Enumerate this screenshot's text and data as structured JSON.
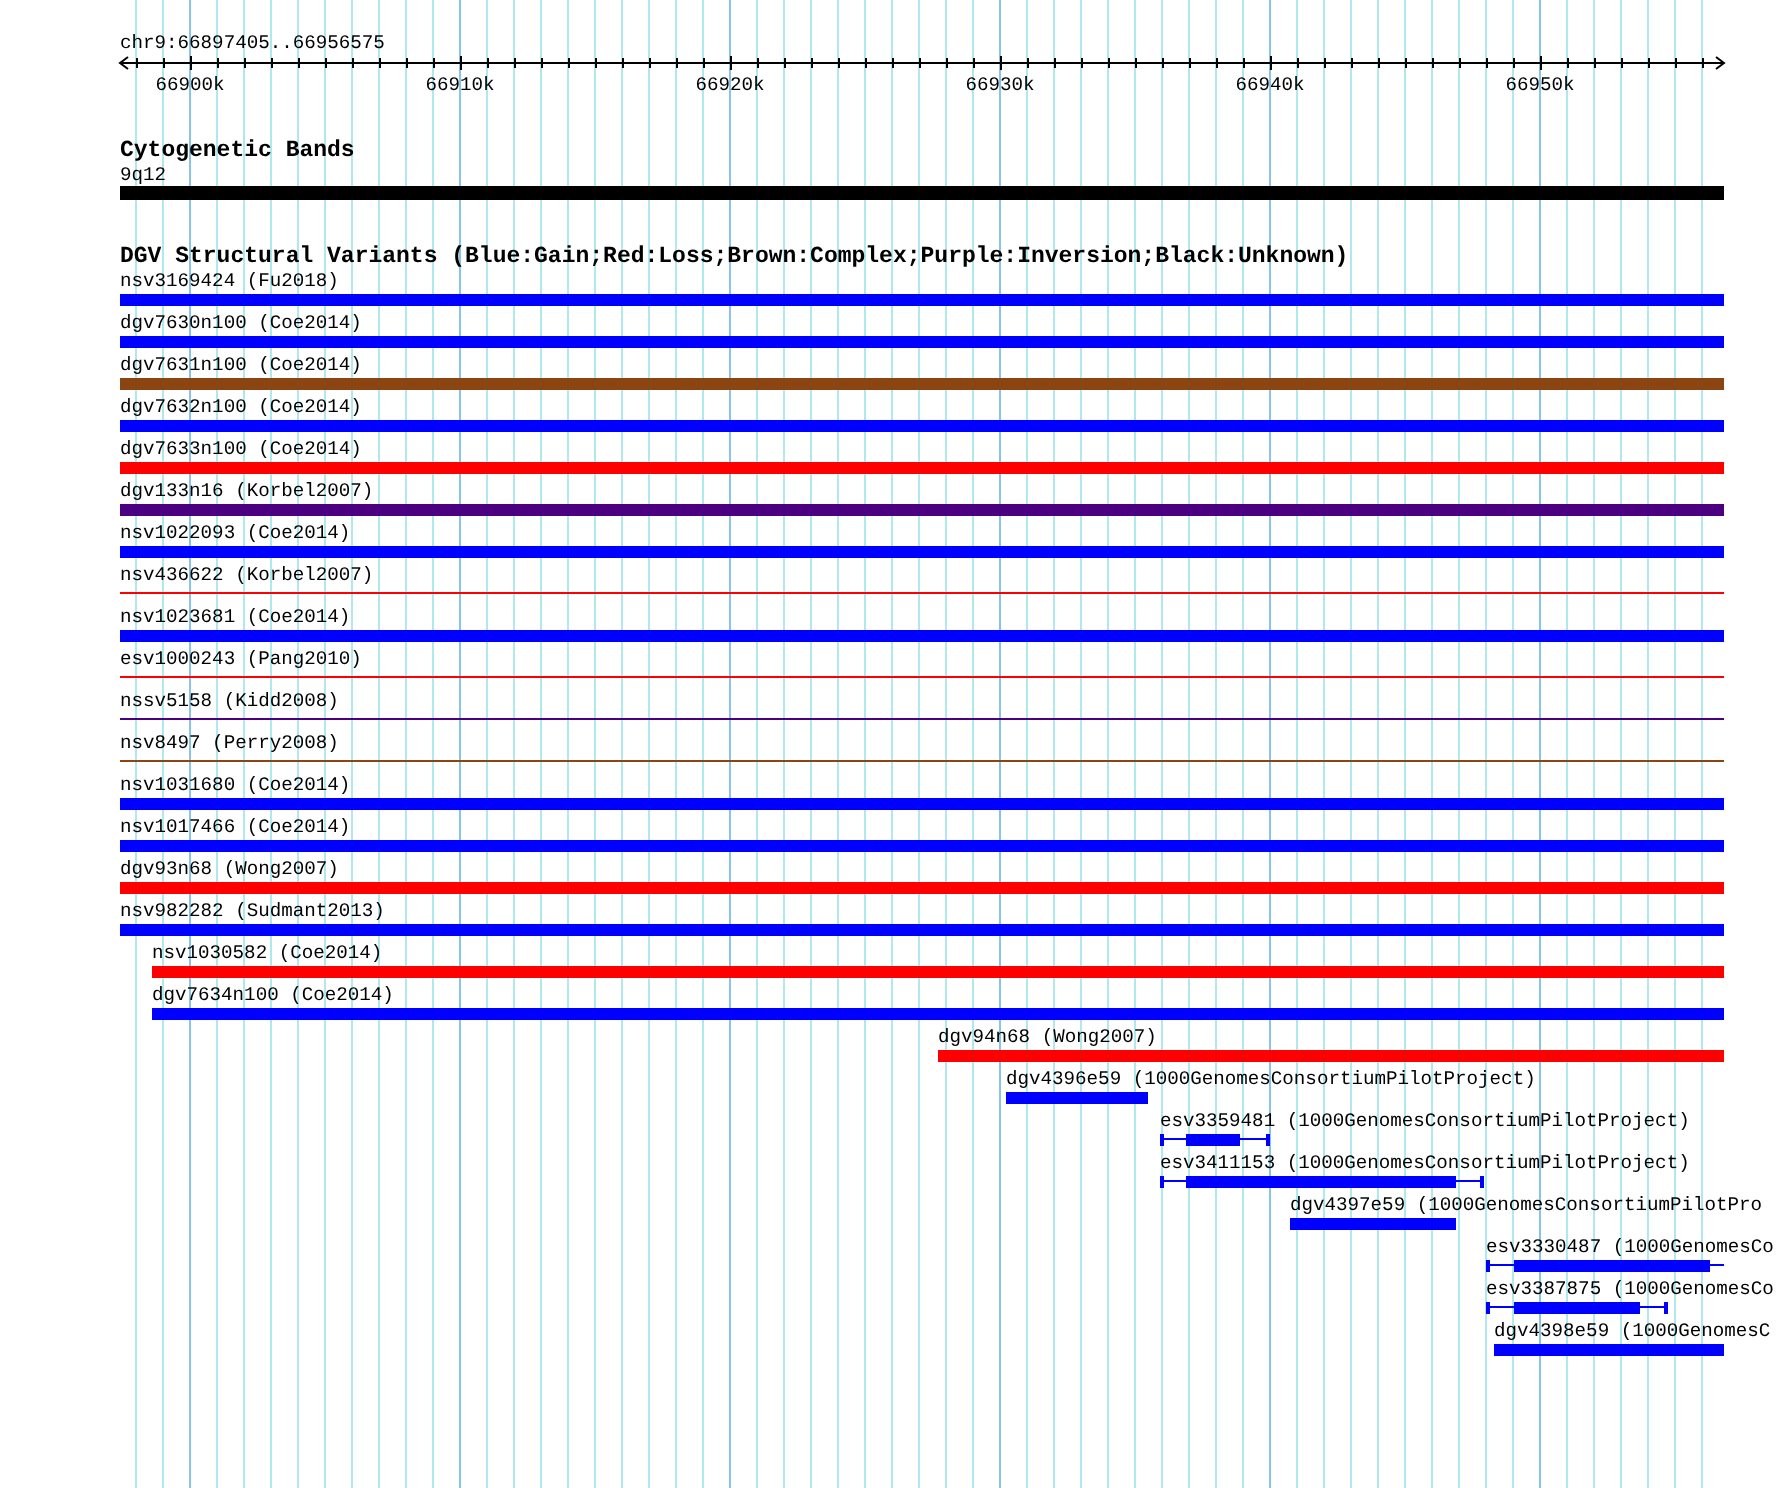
{
  "location": "chr9:66897405..66956575",
  "ruler": {
    "ticks": [
      "66900k",
      "66910k",
      "66920k",
      "66930k",
      "66940k",
      "66950k"
    ]
  },
  "tracks": [
    {
      "title": "Cytogenetic Bands",
      "features": [
        {
          "label": "9q12",
          "kind": "band"
        }
      ]
    },
    {
      "title": "DGV Structural Variants (Blue:Gain;Red:Loss;Brown:Complex;Purple:Inversion;Black:Unknown)",
      "features": [
        {
          "label": "nsv3169424 (Fu2018)",
          "kind": "solid",
          "color": "#0000ff"
        },
        {
          "label": "dgv7630n100 (Coe2014)",
          "kind": "solid",
          "color": "#0000ff"
        },
        {
          "label": "dgv7631n100 (Coe2014)",
          "kind": "solid",
          "color": "#8b4513"
        },
        {
          "label": "dgv7632n100 (Coe2014)",
          "kind": "solid",
          "color": "#0000ff"
        },
        {
          "label": "dgv7633n100 (Coe2014)",
          "kind": "solid",
          "color": "#ff0000"
        },
        {
          "label": "dgv133n16 (Korbel2007)",
          "kind": "solid",
          "color": "#4b0082"
        },
        {
          "label": "nsv1022093 (Coe2014)",
          "kind": "solid",
          "color": "#0000ff"
        },
        {
          "label": "nsv436622 (Korbel2007)",
          "kind": "line",
          "color": "#ff0000"
        },
        {
          "label": "nsv1023681 (Coe2014)",
          "kind": "solid",
          "color": "#0000ff"
        },
        {
          "label": "esv1000243 (Pang2010)",
          "kind": "line",
          "color": "#ff0000"
        },
        {
          "label": "nssv5158 (Kidd2008)",
          "kind": "line",
          "color": "#4b0082"
        },
        {
          "label": "nsv8497 (Perry2008)",
          "kind": "line",
          "color": "#8b4513"
        },
        {
          "label": "nsv1031680 (Coe2014)",
          "kind": "solid",
          "color": "#0000ff"
        },
        {
          "label": "nsv1017466 (Coe2014)",
          "kind": "solid",
          "color": "#0000ff"
        },
        {
          "label": "dgv93n68 (Wong2007)",
          "kind": "solid",
          "color": "#ff0000"
        },
        {
          "label": "nsv982282 (Sudmant2013)",
          "kind": "solid",
          "color": "#0000ff"
        },
        {
          "label": "nsv1030582 (Coe2014)",
          "kind": "solid",
          "color": "#ff0000"
        },
        {
          "label": "dgv7634n100 (Coe2014)",
          "kind": "solid",
          "color": "#0000ff"
        },
        {
          "label": "dgv94n68 (Wong2007)",
          "kind": "solid",
          "color": "#ff0000"
        },
        {
          "label": "dgv4396e59 (1000GenomesConsortiumPilotProject)",
          "kind": "solid",
          "color": "#0000ff"
        },
        {
          "label": "esv3359481 (1000GenomesConsortiumPilotProject)",
          "kind": "ranged",
          "color": "#0000ff"
        },
        {
          "label": "esv3411153 (1000GenomesConsortiumPilotProject)",
          "kind": "ranged",
          "color": "#0000ff"
        },
        {
          "label": "dgv4397e59 (1000GenomesConsortiumPilotPro",
          "kind": "solid",
          "color": "#0000ff"
        },
        {
          "label": "esv3330487 (1000GenomesCo",
          "kind": "ranged",
          "color": "#0000ff"
        },
        {
          "label": "esv3387875 (1000GenomesCo",
          "kind": "ranged",
          "color": "#0000ff"
        },
        {
          "label": "dgv4398e59 (1000GenomesC",
          "kind": "solid",
          "color": "#0000ff"
        }
      ]
    }
  ]
}
